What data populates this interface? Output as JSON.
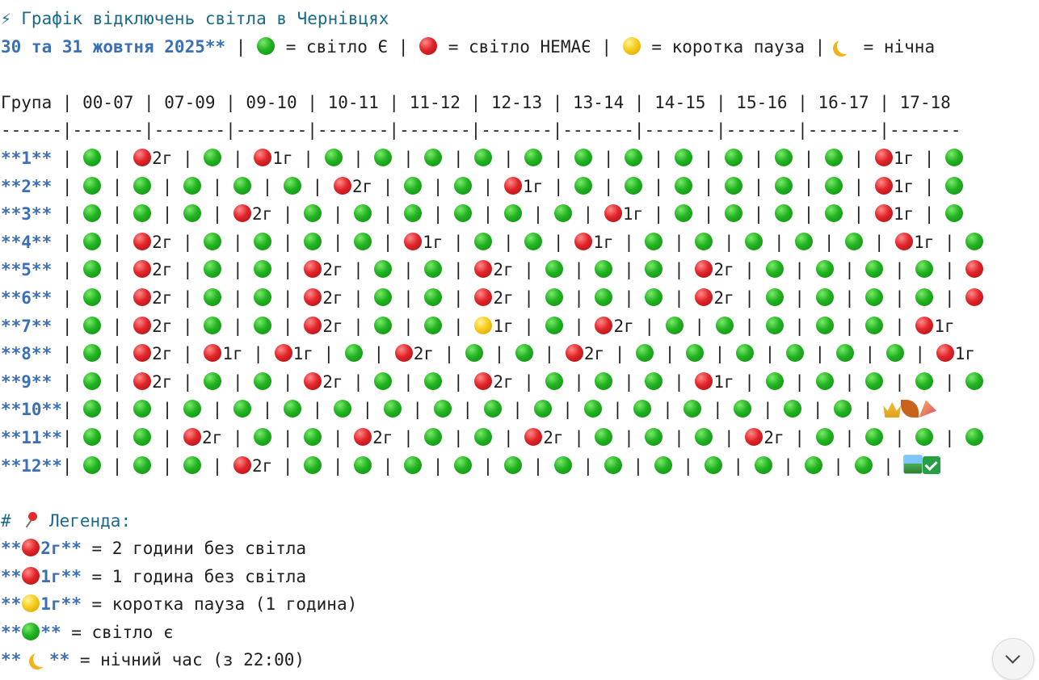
{
  "title": "⚡ Графік відключень світла в Чернівцях",
  "subtitle": {
    "date": "30 та 31 жовтня 2025**",
    "sep1": " | ",
    "green_text": " = світло Є",
    "sep2": " | ",
    "red_text": " = світло НЕМАЄ",
    "sep3": " | ",
    "yellow_text": " = коротка пауза",
    "sep4": " | ",
    "moon_text": " = нічна"
  },
  "table": {
    "header": "Група | 00-07 | 07-09 | 09-10 | 10-11 | 11-12 | 12-13 | 13-14 | 14-15 | 15-16 | 16-17 | 17-18",
    "divider": "------|-------|-------|-------|-------|-------|-------|-------|-------|-------|-------|-------",
    "rows": [
      {
        "label": "**1**",
        "cells": [
          "g",
          "r:2г",
          "g",
          "r:1г",
          "g",
          "g",
          "g",
          "g",
          "g",
          "g",
          "g",
          "g",
          "g",
          "g",
          "g",
          "r:1г",
          "g"
        ]
      },
      {
        "label": "**2**",
        "cells": [
          "g",
          "g",
          "g",
          "g",
          "g",
          "r:2г",
          "g",
          "g",
          "r:1г",
          "g",
          "g",
          "g",
          "g",
          "g",
          "g",
          "r:1г",
          "g"
        ]
      },
      {
        "label": "**3**",
        "cells": [
          "g",
          "g",
          "g",
          "r:2г",
          "g",
          "g",
          "g",
          "g",
          "g",
          "g",
          "r:1г",
          "g",
          "g",
          "g",
          "g",
          "r:1г",
          "g"
        ]
      },
      {
        "label": "**4**",
        "cells": [
          "g",
          "r:2г",
          "g",
          "g",
          "g",
          "g",
          "r:1г",
          "g",
          "g",
          "r:1г",
          "g",
          "g",
          "g",
          "g",
          "g",
          "r:1г",
          "g"
        ]
      },
      {
        "label": "**5**",
        "cells": [
          "g",
          "r:2г",
          "g",
          "g",
          "r:2г",
          "g",
          "g",
          "r:2г",
          "g",
          "g",
          "g",
          "r:2г",
          "g",
          "g",
          "g",
          "g",
          "r"
        ]
      },
      {
        "label": "**6**",
        "cells": [
          "g",
          "r:2г",
          "g",
          "g",
          "r:2г",
          "g",
          "g",
          "r:2г",
          "g",
          "g",
          "g",
          "r:2г",
          "g",
          "g",
          "g",
          "g",
          "r"
        ]
      },
      {
        "label": "**7**",
        "cells": [
          "g",
          "r:2г",
          "g",
          "g",
          "r:2г",
          "g",
          "g",
          "y:1г",
          "g",
          "r:2г",
          "g",
          "g",
          "g",
          "g",
          "g",
          "r:1г"
        ]
      },
      {
        "label": "**8**",
        "cells": [
          "g",
          "r:2г",
          "r:1г",
          "r:1г",
          "g",
          "r:2г",
          "g",
          "g",
          "r:2г",
          "g",
          "g",
          "g",
          "g",
          "g",
          "g",
          "r:1г"
        ]
      },
      {
        "label": "**9**",
        "cells": [
          "g",
          "r:2г",
          "g",
          "g",
          "r:2г",
          "g",
          "g",
          "r:2г",
          "g",
          "g",
          "g",
          "r:1г",
          "g",
          "g",
          "g",
          "g",
          "g"
        ]
      },
      {
        "label": "**10**",
        "cells": [
          "g",
          "g",
          "g",
          "g",
          "g",
          "g",
          "g",
          "g",
          "g",
          "g",
          "g",
          "g",
          "g",
          "g",
          "g",
          "g",
          "e:party"
        ]
      },
      {
        "label": "**11**",
        "cells": [
          "g",
          "g",
          "r:2г",
          "g",
          "g",
          "r:2г",
          "g",
          "g",
          "r:2г",
          "g",
          "g",
          "g",
          "r:2г",
          "g",
          "g",
          "g",
          "g"
        ]
      },
      {
        "label": "**12**",
        "cells": [
          "g",
          "g",
          "g",
          "r:2г",
          "g",
          "g",
          "g",
          "g",
          "g",
          "g",
          "g",
          "g",
          "g",
          "g",
          "g",
          "g",
          "e:pic"
        ]
      }
    ]
  },
  "legend": {
    "heading_prefix": "# ",
    "heading": " Легенда:",
    "items": [
      {
        "pre": "**",
        "marker": "r",
        "code": "2г**",
        "text": " = 2 години без світла"
      },
      {
        "pre": "**",
        "marker": "r",
        "code": "1г**",
        "text": " = 1 година без світла"
      },
      {
        "pre": "**",
        "marker": "y",
        "code": "1г**",
        "text": " = коротка пауза (1 година)"
      },
      {
        "pre": "**",
        "marker": "g",
        "code": "**",
        "text": " = світло є"
      },
      {
        "pre": "** ",
        "marker": "moon",
        "code": "**",
        "text": " = нічний час (з 22:00)"
      }
    ]
  },
  "colors": {
    "accent_blue": "#3b6fb6",
    "heading_teal": "#1b6a8a",
    "green": "#22b322",
    "red": "#e2262a",
    "yellow": "#f7cc1c"
  },
  "icons": {
    "lightning": "lightning-icon",
    "pin": "pin-icon",
    "scroll_down": "chevron-down-icon"
  }
}
